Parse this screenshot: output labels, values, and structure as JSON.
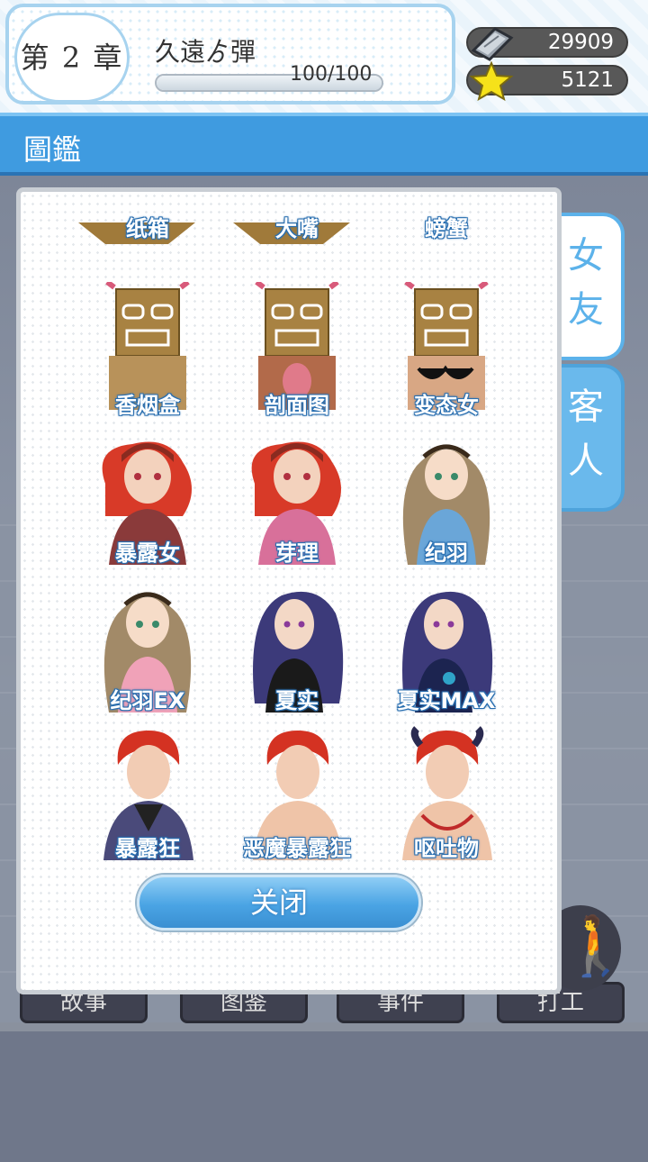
{
  "header": {
    "chapter": "第 2 章",
    "story_name": "久遠ゟ彈",
    "progress_text": "100/100",
    "progress": 1.0,
    "gems": "29909",
    "stars": "5121"
  },
  "section": {
    "title": "圖鑑"
  },
  "tabs": [
    {
      "label": "女\n友",
      "active": false
    },
    {
      "label": "客\n人",
      "active": true
    }
  ],
  "partial_row": [
    "纸箱",
    "大嘴",
    "螃蟹"
  ],
  "catalog": [
    {
      "label": "香烟盒",
      "icon": "box-head-portrait"
    },
    {
      "label": "剖面图",
      "icon": "box-head-portrait"
    },
    {
      "label": "变态女",
      "icon": "box-head-portrait"
    },
    {
      "label": "暴露女",
      "icon": "red-hair-girl-portrait"
    },
    {
      "label": "芽理",
      "icon": "red-hair-girl-portrait"
    },
    {
      "label": "纪羽",
      "icon": "brown-hair-girl-portrait"
    },
    {
      "label": "纪羽EX",
      "icon": "brown-hair-girl-portrait"
    },
    {
      "label": "夏实",
      "icon": "purple-hair-girl-portrait"
    },
    {
      "label": "夏实MAX",
      "icon": "purple-hair-girl-portrait"
    },
    {
      "label": "暴露狂",
      "icon": "red-hair-man-portrait"
    },
    {
      "label": "恶魔暴露狂",
      "icon": "red-hair-man-portrait"
    },
    {
      "label": "呕吐物",
      "icon": "red-hair-man-portrait"
    }
  ],
  "close_label": "关闭",
  "background_buttons": [
    "故事",
    "图鉴",
    "事件",
    "打工"
  ],
  "colors": {
    "accent": "#3f9be0",
    "tab_active": "#6ab9ec",
    "label_outline": "#2a6fb0"
  }
}
